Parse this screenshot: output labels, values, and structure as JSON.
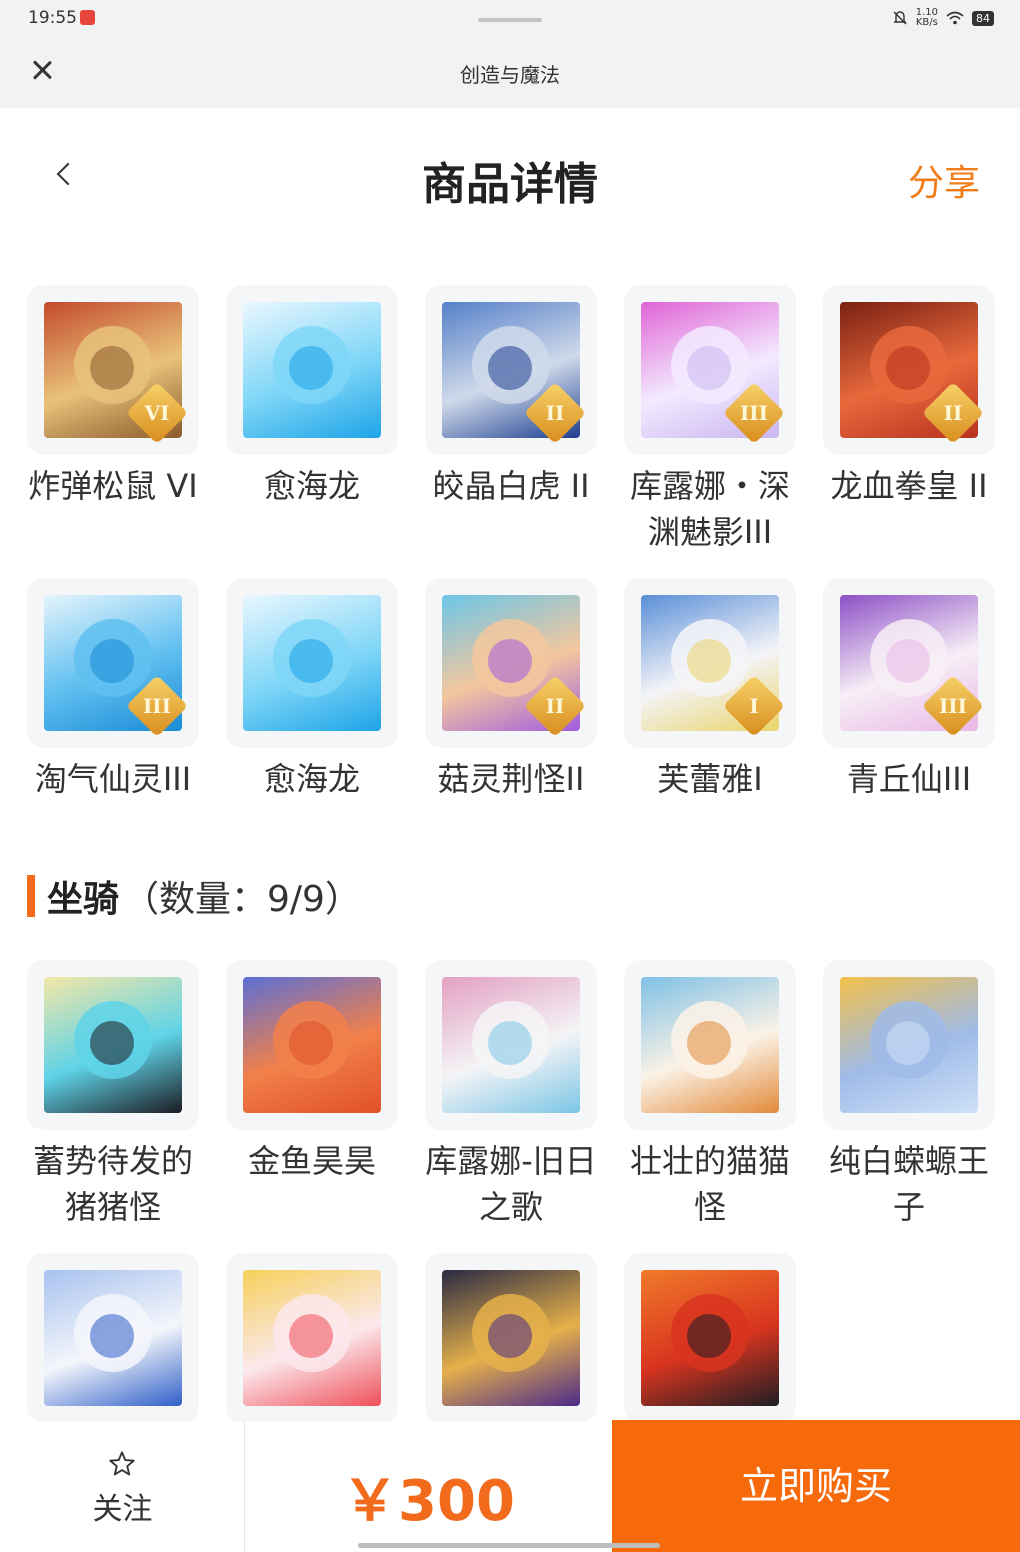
{
  "status": {
    "time": "19:55",
    "speed": "1.10",
    "speed_unit": "KB/s",
    "battery": "84"
  },
  "app_bar": {
    "title": "创造与魔法"
  },
  "header": {
    "title": "商品详情",
    "share": "分享"
  },
  "pets": [
    [
      {
        "name": "炸弹松鼠 VI",
        "rank": "VI",
        "colors": [
          "#8b5a2b",
          "#e8c27a",
          "#c44b2d"
        ]
      },
      {
        "name": "愈海龙",
        "rank": "",
        "colors": [
          "#1ea4e8",
          "#7fd6f7",
          "#e9f7ff"
        ]
      },
      {
        "name": "皎晶白虎 II",
        "rank": "II",
        "colors": [
          "#1d3f8f",
          "#cfd9ea",
          "#5580c9"
        ]
      },
      {
        "name": "库露娜・深渊魅影III",
        "rank": "III",
        "colors": [
          "#c9b6f0",
          "#f3eaff",
          "#e064d6"
        ]
      },
      {
        "name": "龙血拳皇 II",
        "rank": "II",
        "colors": [
          "#b8321f",
          "#e8693c",
          "#7a2012"
        ]
      }
    ],
    [
      {
        "name": "淘气仙灵III",
        "rank": "III",
        "colors": [
          "#1b8bd6",
          "#5fbff0",
          "#e4f4fc"
        ]
      },
      {
        "name": "愈海龙",
        "rank": "",
        "colors": [
          "#1ea4e8",
          "#7fd6f7",
          "#e9f7ff"
        ]
      },
      {
        "name": "菇灵荆怪II",
        "rank": "II",
        "colors": [
          "#a05ce0",
          "#f3c79e",
          "#6cc6e8"
        ]
      },
      {
        "name": "芙蕾雅I",
        "rank": "I",
        "colors": [
          "#e9d46a",
          "#f4f4f8",
          "#5a8fd8"
        ]
      },
      {
        "name": "青丘仙III",
        "rank": "III",
        "colors": [
          "#e9b8e6",
          "#f7eef6",
          "#8d4fc6"
        ]
      }
    ]
  ],
  "mounts_section": {
    "title": "坐骑",
    "count": "（数量：9/9）"
  },
  "mounts": [
    [
      {
        "name": "蓄势待发的猪猪怪",
        "colors": [
          "#1c1c22",
          "#5fd3e8",
          "#f4e7a6"
        ]
      },
      {
        "name": "金鱼昊昊",
        "colors": [
          "#e0502a",
          "#f2804a",
          "#5b6fd6"
        ]
      },
      {
        "name": "库露娜-旧日之歌",
        "colors": [
          "#7cc6e6",
          "#f4f4f6",
          "#e3a0c2"
        ]
      },
      {
        "name": "壮壮的猫猫怪",
        "colors": [
          "#e28a3a",
          "#fbf2e6",
          "#7fc1e6"
        ]
      },
      {
        "name": "纯白蝾螈王子",
        "colors": [
          "#cfe1f8",
          "#9fbbe8",
          "#f2c04a"
        ]
      }
    ],
    [
      {
        "name": "",
        "colors": [
          "#2f5fc8",
          "#f4f6fb",
          "#a8c2ef"
        ]
      },
      {
        "name": "",
        "colors": [
          "#ef4f59",
          "#fbe8ec",
          "#f6d05a"
        ]
      },
      {
        "name": "",
        "colors": [
          "#4c2a8a",
          "#e5b04a",
          "#2a2a44"
        ]
      },
      {
        "name": "",
        "colors": [
          "#1e1e24",
          "#d8341f",
          "#f07a2a"
        ]
      }
    ]
  ],
  "bottom": {
    "follow": "关注",
    "price": "￥300",
    "buy": "立即购买"
  },
  "accent": "#f76a0c"
}
